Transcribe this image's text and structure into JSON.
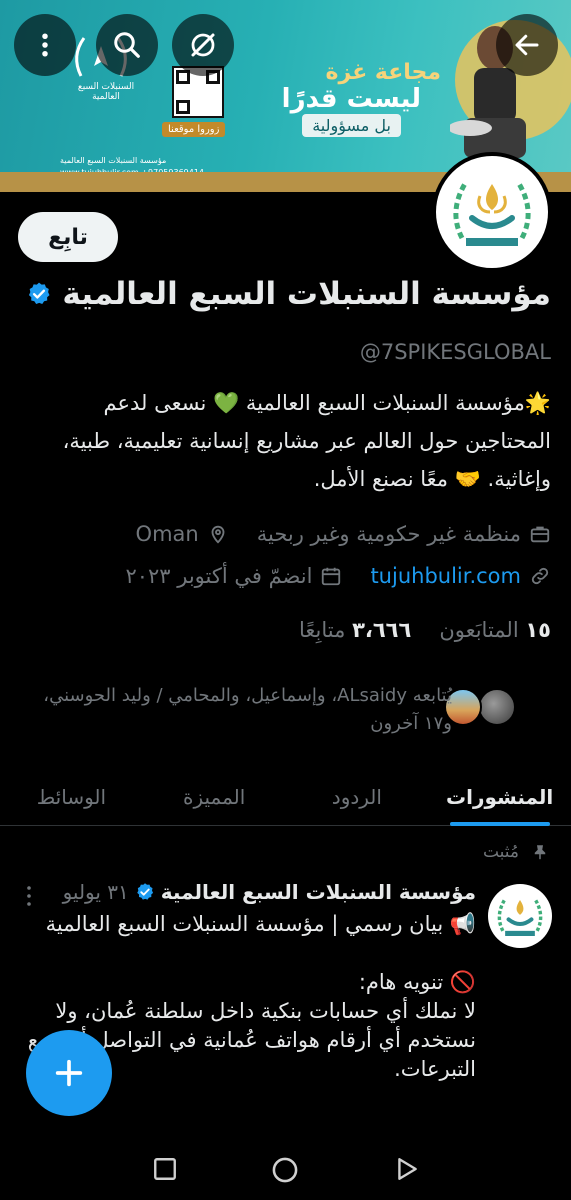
{
  "banner": {
    "headline1": "مجاعة غزة",
    "headline2": "ليست قدرًا",
    "headline3": "بل مسؤولية",
    "qr_label": "زوروا موقعنا",
    "logo_text": "السنبلات السبع العالمية",
    "logo_subtext": "SEVEN SPIKES GLOBAL",
    "foot_line": "مؤسسة السنبلات السبع العالمية",
    "foot_line2": "www.tujuhbulir.com  +97059369414"
  },
  "top_buttons": {
    "back_icon": "arrow-left-icon",
    "grok_icon": "grok-icon",
    "search_icon": "search-icon",
    "more_icon": "more-vertical-icon"
  },
  "profile": {
    "follow_label": "تابِع",
    "name": "مؤسسة السنبلات السبع العالمية",
    "handle": "@7SPIKESGLOBAL",
    "bio_line1": "🌟مؤسسة السنبلات السبع العالمية 💚 نسعى لدعم",
    "bio_line2": "المحتاجين حول العالم عبر مشاريع إنسانية تعليمية، طبية،",
    "bio_line3": "وإغاثية. 🤝 معًا نصنع الأمل.",
    "category": "منظمة غير حكومية وغير ربحية",
    "location": "Oman",
    "website": "tujuhbulir.com",
    "joined": "انضمّ في أكتوبر ٢٠٢٣",
    "following_count": "١٥",
    "following_label": "المتابَعون",
    "followers_count": "٣،٦٦٦",
    "followers_label": "متابِعًا",
    "followed_by_line1": "يُتابعه ALsaidy، وإسماعيل، والمحامي / وليد الحوسني،",
    "followed_by_line2": "و١٧ آخرون"
  },
  "tabs": [
    {
      "label": "المنشورات",
      "active": true
    },
    {
      "label": "الردود",
      "active": false
    },
    {
      "label": "المميزة",
      "active": false
    },
    {
      "label": "الوسائط",
      "active": false
    }
  ],
  "pinned_post": {
    "pinned_label": "مُثبت",
    "author": "مؤسسة السنبلات السبع العالمية",
    "date": "٣١ يوليو",
    "line1": "📢 بيان رسمي | مؤسسة السنبلات السبع العالمية",
    "line2": "🚫 تنويه هام:",
    "line3": "لا نملك أي حسابات بنكية داخل سلطنة عُمان، ولا",
    "line4": "نستخدم أي أرقام هواتف عُمانية في التواصل أو جمع",
    "line5": "التبرعات."
  },
  "colors": {
    "accent": "#1d9bf0",
    "muted": "#71767b",
    "text": "#e7e9ea",
    "background": "#000000"
  }
}
